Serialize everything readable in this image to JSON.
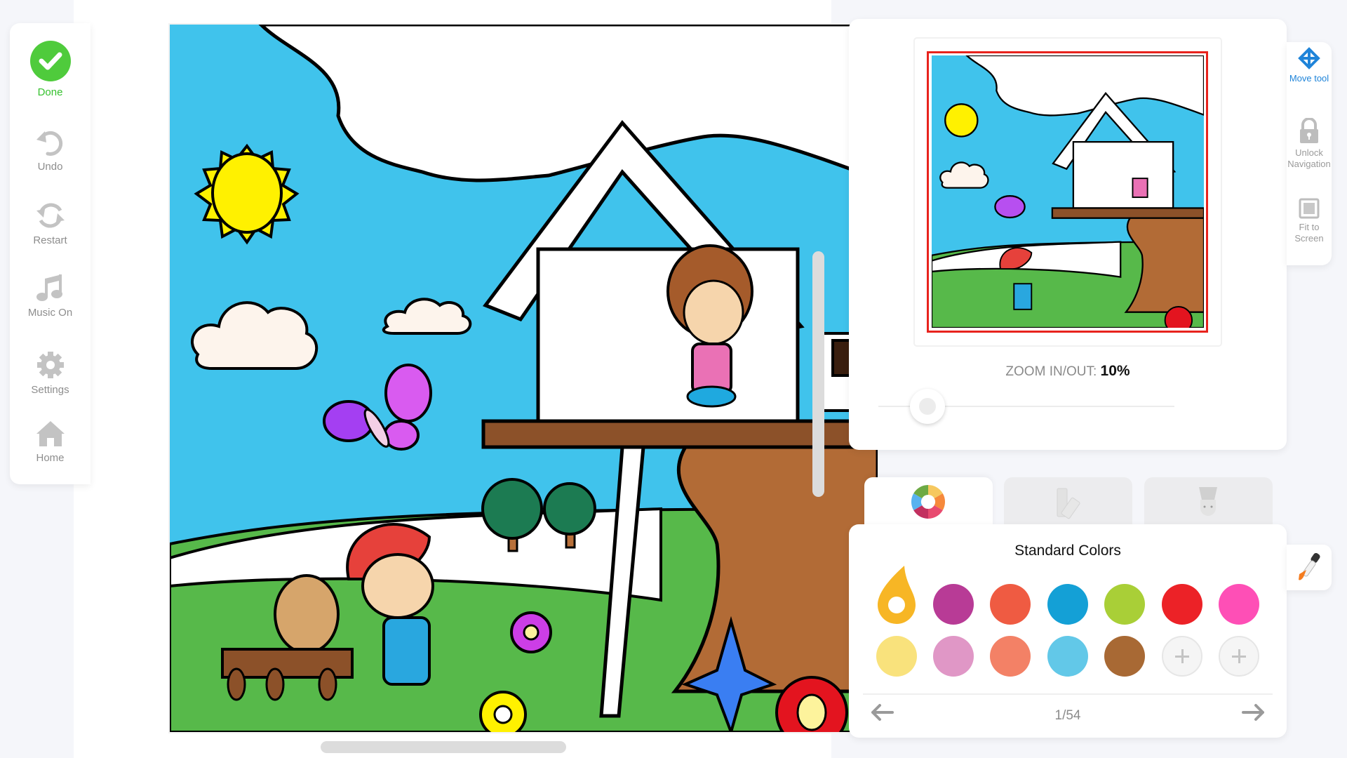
{
  "sidebar": {
    "items": [
      {
        "id": "done",
        "label": "Done",
        "icon": "check-circle-icon"
      },
      {
        "id": "undo",
        "label": "Undo",
        "icon": "undo-icon"
      },
      {
        "id": "restart",
        "label": "Restart",
        "icon": "restart-icon"
      },
      {
        "id": "music",
        "label": "Music On",
        "icon": "music-note-icon"
      },
      {
        "id": "settings",
        "label": "Settings",
        "icon": "gear-icon"
      },
      {
        "id": "home",
        "label": "Home",
        "icon": "home-icon"
      }
    ]
  },
  "canvas": {
    "subject": "Tree house coloring page"
  },
  "navigator": {
    "zoom_label": "ZOOM IN/OUT:",
    "zoom_value": "10%",
    "zoom_fraction": 0.1
  },
  "tools": {
    "move": "Move tool",
    "unlock_line1": "Unlock",
    "unlock_line2": "Navigation",
    "fit_line1": "Fit to",
    "fit_line2": "Screen"
  },
  "tabs": [
    {
      "name": "color-wheel-tab",
      "icon": "color-wheel-icon",
      "active": true
    },
    {
      "name": "swatch-book-tab",
      "icon": "swatch-book-icon",
      "active": false
    },
    {
      "name": "brush-tab",
      "icon": "brush-icon",
      "active": false
    }
  ],
  "palette": {
    "title": "Standard Colors",
    "selected": "#f7b625",
    "rows": [
      [
        "#f7b625",
        "#b83b96",
        "#ef5b42",
        "#14a0d6",
        "#a9cf37",
        "#ec2227",
        "#fe4fb6"
      ],
      [
        "#f9e27c",
        "#e097c6",
        "#f38166",
        "#62c8e8",
        "#a86934",
        "add",
        "add"
      ]
    ],
    "page": "1/54"
  },
  "colors": {
    "accent_green": "#35c12e",
    "accent_blue": "#1f84d9",
    "viewport_red": "#e8231d"
  }
}
